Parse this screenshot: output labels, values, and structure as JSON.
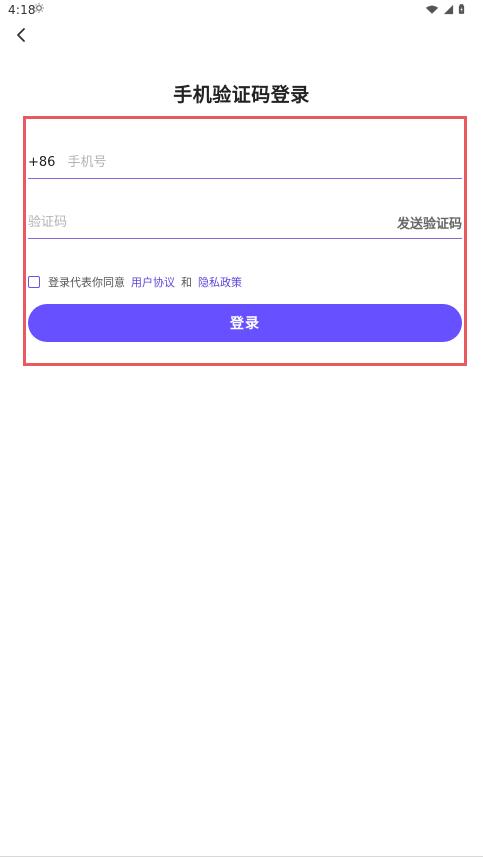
{
  "status_bar": {
    "time": "4:18"
  },
  "header": {
    "title": "手机验证码登录"
  },
  "form": {
    "country_code": "+86",
    "phone_placeholder": "手机号",
    "code_placeholder": "验证码",
    "send_code_label": "发送验证码",
    "agreement_text": "登录代表你同意",
    "user_agreement_label": "用户协议",
    "and_text": "和",
    "privacy_policy_label": "隐私政策",
    "login_label": "登录"
  },
  "colors": {
    "accent": "#6650ff",
    "link": "#5c48d8",
    "highlight_border": "#e85a5f",
    "field_underline": "#8a66d8"
  }
}
